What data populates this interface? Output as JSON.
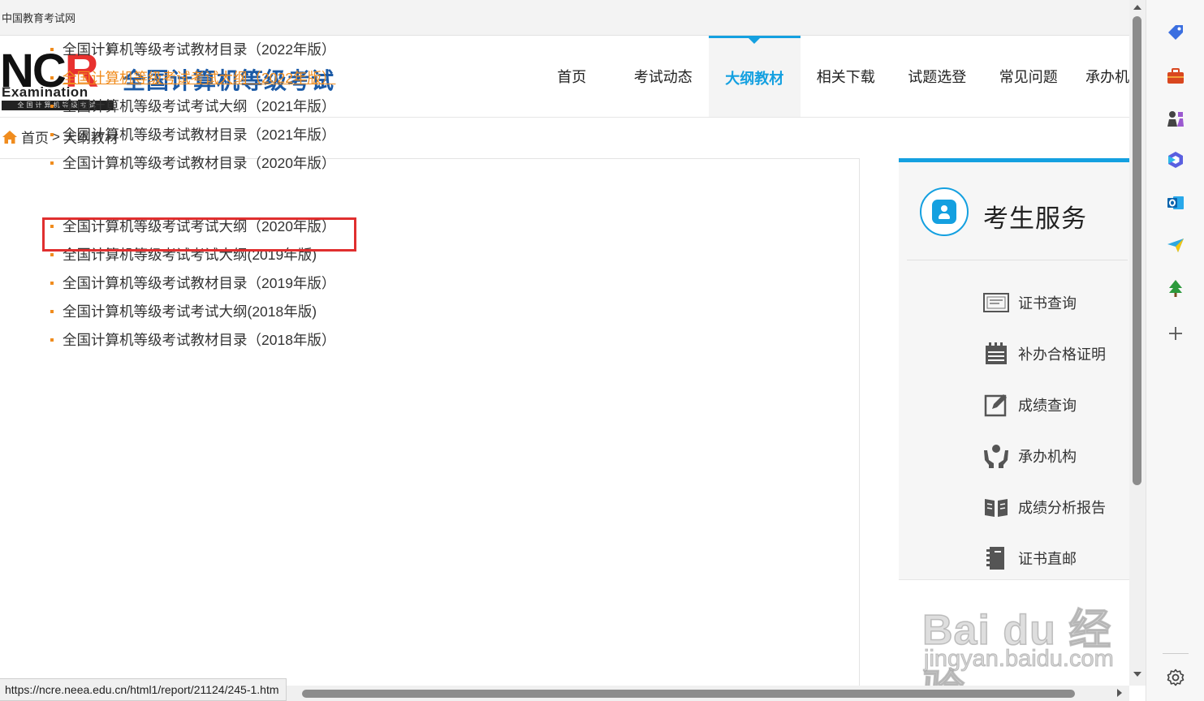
{
  "browser": {
    "tab_title": "中国教育考试网",
    "status_url": "https://ncre.neea.edu.cn/html1/report/21124/245-1.htm"
  },
  "header": {
    "logo_letters": "NCR",
    "logo_exam": "Examination",
    "logo_band": "全国计算机等级考试",
    "site_title": "全国计算机等级考试"
  },
  "nav": {
    "items": [
      "首页",
      "考试动态",
      "大纲教材",
      "相关下载",
      "试题选登",
      "常见问题",
      "承办机"
    ],
    "active": "大纲教材"
  },
  "breadcrumb": {
    "home": "首页",
    "separator": ">",
    "current": "大纲教材"
  },
  "documents": {
    "group1": [
      "全国计算机等级考试教材目录（2022年版）",
      "全国计算机等级考试考试大纲（2022年版）",
      "全国计算机等级考试考试大纲（2021年版）",
      "全国计算机等级考试教材目录（2021年版）",
      "全国计算机等级考试教材目录（2020年版）"
    ],
    "group2": [
      "全国计算机等级考试考试大纲（2020年版）",
      "全国计算机等级考试考试大纲(2019年版)",
      "全国计算机等级考试教材目录（2019年版）",
      "全国计算机等级考试考试大纲(2018年版)",
      "全国计算机等级考试教材目录（2018年版）"
    ],
    "hovered_item": "全国计算机等级考试考试大纲（2022年版）"
  },
  "sidebar": {
    "title": "考生服务",
    "services": [
      {
        "label": "证书查询",
        "icon": "certificate-icon"
      },
      {
        "label": "补办合格证明",
        "icon": "calendar-icon"
      },
      {
        "label": "成绩查询",
        "icon": "edit-icon"
      },
      {
        "label": "承办机构",
        "icon": "hands-icon"
      },
      {
        "label": "成绩分析报告",
        "icon": "book-icon"
      },
      {
        "label": "证书直邮",
        "icon": "mail-book-icon"
      }
    ]
  },
  "edge_sidebar": {
    "icons": [
      "tag-icon",
      "briefcase-icon",
      "games-icon",
      "copilot-icon",
      "outlook-icon",
      "send-icon",
      "tree-icon",
      "add-icon",
      "settings-icon"
    ]
  },
  "watermark": {
    "brand": "Bai du 经验",
    "domain": "jingyan.baidu.com"
  },
  "colors": {
    "accent": "#14a0e0",
    "title_blue": "#1b5aa6",
    "bullet_orange": "#f08c1e",
    "highlight_red": "#e02f2f"
  }
}
